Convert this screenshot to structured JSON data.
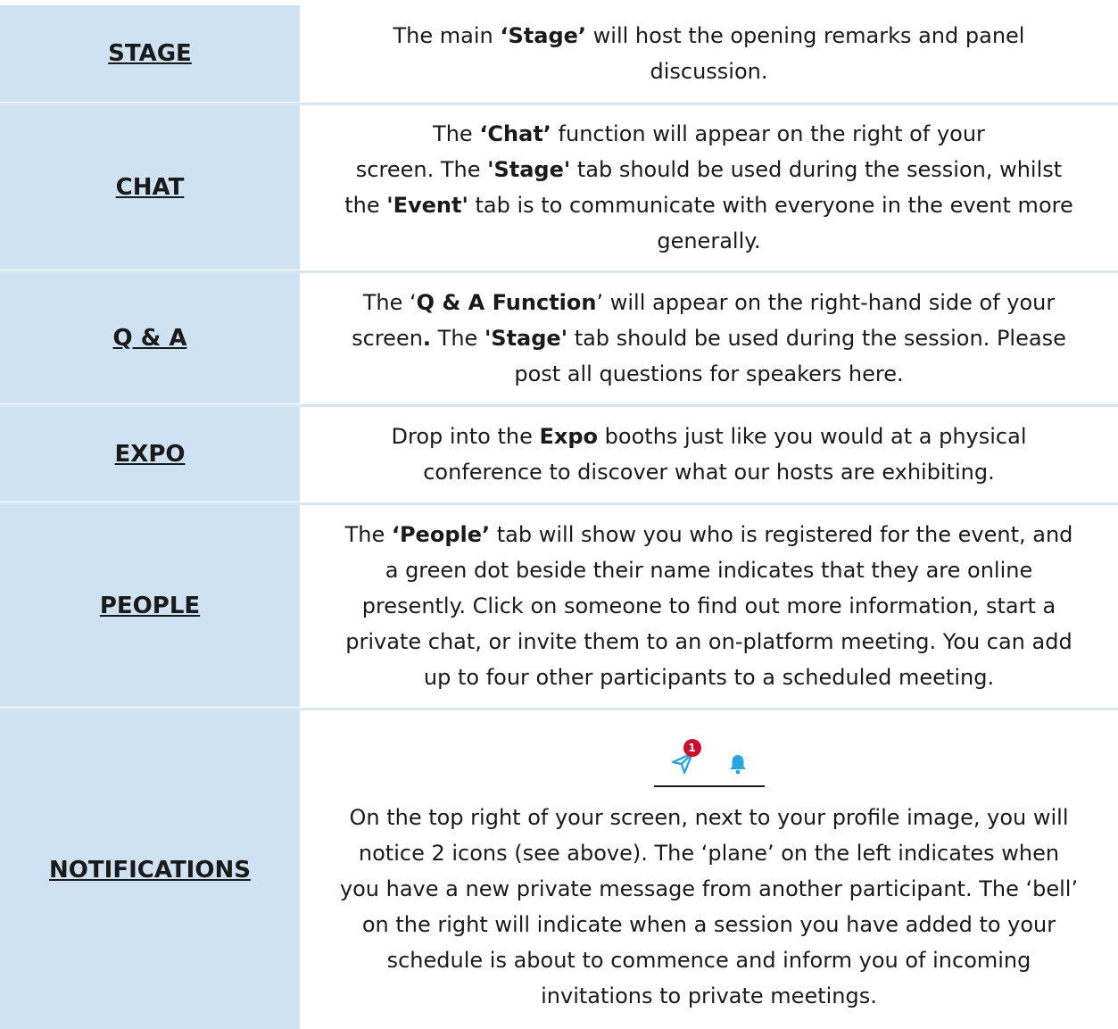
{
  "colors": {
    "label_bg": "#cfe2f3",
    "icon_blue": "#2aa5e0",
    "badge_red": "#c8102e"
  },
  "rows": [
    {
      "label": "STAGE",
      "parts": [
        [
          "The main ",
          false
        ],
        [
          "‘Stage’",
          true
        ],
        [
          " will host the opening remarks and panel",
          false
        ],
        [
          "\n",
          false
        ],
        [
          "discussion.",
          false
        ]
      ]
    },
    {
      "label": "CHAT",
      "parts": [
        [
          "The ",
          false
        ],
        [
          "‘Chat’",
          true
        ],
        [
          " function will appear on the right of your",
          false
        ],
        [
          "\n",
          false
        ],
        [
          "screen. The ",
          false
        ],
        [
          "'Stage'",
          true
        ],
        [
          " tab should be used during the session, whilst",
          false
        ],
        [
          "\n",
          false
        ],
        [
          "the ",
          false
        ],
        [
          "'Event'",
          true
        ],
        [
          " tab is to communicate with everyone in the event more",
          false
        ],
        [
          "\n",
          false
        ],
        [
          "generally.",
          false
        ]
      ]
    },
    {
      "label": "Q & A",
      "parts": [
        [
          "The ‘",
          false
        ],
        [
          "Q & A Function",
          true
        ],
        [
          "’ will appear on the right-hand side of your",
          false
        ],
        [
          "\n",
          false
        ],
        [
          "screen",
          false
        ],
        [
          ".",
          true
        ],
        [
          " The ",
          false
        ],
        [
          "'Stage'",
          true
        ],
        [
          " tab should be used during the session. Please",
          false
        ],
        [
          "\n",
          false
        ],
        [
          "post all questions for speakers here.",
          false
        ]
      ]
    },
    {
      "label": "EXPO",
      "parts": [
        [
          "Drop into the ",
          false
        ],
        [
          "Expo",
          true
        ],
        [
          " booths just like you would at a physical",
          false
        ],
        [
          "\n",
          false
        ],
        [
          "conference to discover what our hosts are exhibiting.",
          false
        ]
      ]
    },
    {
      "label": "PEOPLE",
      "parts": [
        [
          "The ",
          false
        ],
        [
          "‘People’",
          true
        ],
        [
          " tab will show you who is registered for the event, and",
          false
        ],
        [
          "\n",
          false
        ],
        [
          "a green dot beside their name indicates that they are online",
          false
        ],
        [
          "\n",
          false
        ],
        [
          "presently. Click on someone to find out more information, start a",
          false
        ],
        [
          "\n",
          false
        ],
        [
          "private chat, or invite them to an on-platform meeting. You can add",
          false
        ],
        [
          "\n",
          false
        ],
        [
          "up to four other participants to a scheduled meeting.",
          false
        ]
      ]
    },
    {
      "label": "NOTIFICATIONS",
      "icons": {
        "left_icon": "paper-plane-icon",
        "badge_count": "1",
        "right_icon": "bell-icon"
      },
      "parts": [
        [
          "On the top right of your screen, next to your profile image, you will",
          false
        ],
        [
          "\n",
          false
        ],
        [
          "notice 2 icons (see above). The ‘plane’ on the left indicates when",
          false
        ],
        [
          "\n",
          false
        ],
        [
          "you have a new private message from another participant. The ‘bell’",
          false
        ],
        [
          "\n",
          false
        ],
        [
          "on the right will indicate when a session you have added to your",
          false
        ],
        [
          "\n",
          false
        ],
        [
          "schedule is about to commence and inform you of incoming",
          false
        ],
        [
          "\n",
          false
        ],
        [
          "invitations to private meetings.",
          false
        ]
      ]
    }
  ]
}
